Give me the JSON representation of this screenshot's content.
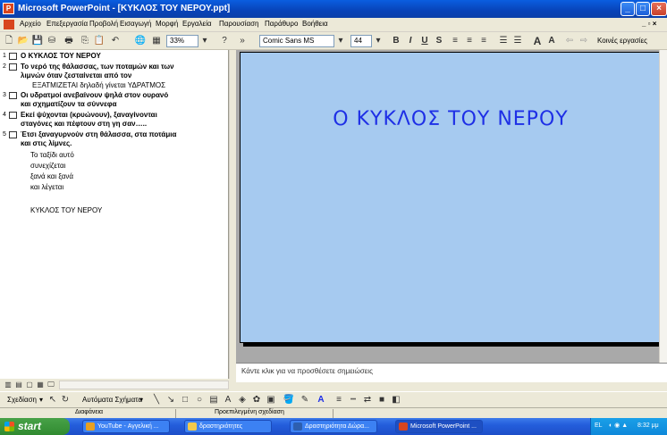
{
  "window": {
    "title": "Microsoft PowerPoint - [ΚΥΚΛΟΣ ΤΟΥ ΝΕΡΟΥ.ppt]"
  },
  "menu": {
    "items": [
      "Αρχείο",
      "Επεξεργασία",
      "Προβολή",
      "Εισαγωγή",
      "Μορφή",
      "Εργαλεία",
      "Παρουσίαση",
      "Παράθυρο",
      "Βοήθεια"
    ]
  },
  "toolbar": {
    "zoom": "33%",
    "font": "Comic Sans MS",
    "font_size": "44",
    "bold": "B",
    "italic": "I",
    "underline": "U",
    "shadow": "S",
    "tasks": "Κοινές εργασίες"
  },
  "outline": {
    "slides": [
      {
        "num": "1",
        "title": "Ο ΚΥΚΛΟΣ ΤΟΥ ΝΕΡΟΥ",
        "body": []
      },
      {
        "num": "2",
        "title": "Το νερό της θάλασσας, των ποταμών και των",
        "title2": "λιμνών όταν ζεσταίνεται από τον",
        "body": [
          "ΕΞΑΤΜΙΖΕΤΑΙ δηλαδή γίνεται ΥΔΡΑΤΜΟΣ"
        ]
      },
      {
        "num": "3",
        "title": "Οι υδρατμοί ανεβαίνουν ψηλά στον ουρανό",
        "title2": "και σχηματίζουν τα σύννεφα",
        "body": []
      },
      {
        "num": "4",
        "title": "Εκεί ψύχονται (κρυώνουν), ξαναγίνονται",
        "title2": "σταγόνες και πέφτουν στη γη σαν…..",
        "body": []
      },
      {
        "num": "5",
        "title": "Έτσι ξαναγυρνούν στη θάλασσα, στα ποτάμια",
        "title2": "και στις λίμνες.",
        "body": [
          "Το ταξίδι αυτό",
          "συνεχίζεται",
          "ξανά και ξανά",
          "και λέγεται",
          "",
          "ΚΥΚΛΟΣ ΤΟΥ ΝΕΡΟΥ"
        ]
      }
    ]
  },
  "slide": {
    "title": "Ο ΚΥΚΛΟΣ ΤΟΥ ΝΕΡΟΥ",
    "background": "#A6CAF0",
    "title_color": "#1E2FE6"
  },
  "notes": {
    "placeholder": "Κάντε κλικ για να προσθέσετε σημειώσεις"
  },
  "drawing": {
    "draw_label": "Σχεδίαση",
    "autoshapes_label": "Αυτόματα Σχήματα"
  },
  "status": {
    "slide": "Διαφάνεια",
    "design": "Προεπιλεγμένη σχεδίαση"
  },
  "taskbar": {
    "start": "start",
    "tasks": [
      {
        "label": "YouTube - Αγγελική ...",
        "icon_color": "#E8A020"
      },
      {
        "label": "δραστηριότητες",
        "icon_color": "#F2C94C"
      },
      {
        "label": "Δραστηριότητα Δώρα...",
        "icon_color": "#2D5FB0"
      },
      {
        "label": "Microsoft PowerPoint ...",
        "icon_color": "#D8451E"
      }
    ],
    "lang": "EL",
    "time": "8:32 μμ"
  }
}
